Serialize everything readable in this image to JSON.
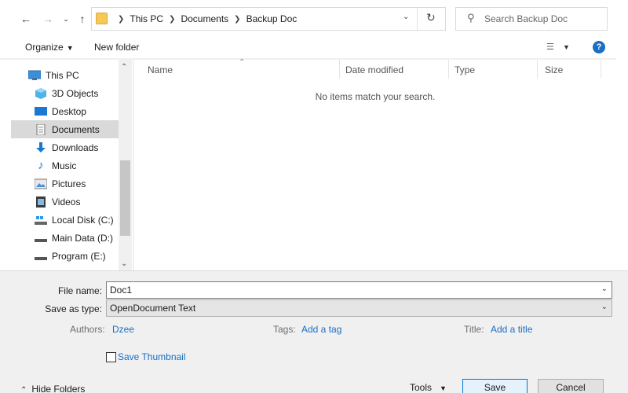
{
  "nav": {
    "back_icon": "arrow-left-icon",
    "forward_icon": "arrow-right-icon",
    "recent_icon": "chevron-down-icon",
    "up_icon": "arrow-up-icon"
  },
  "address": {
    "crumbs": [
      "This PC",
      "Documents",
      "Backup Doc"
    ]
  },
  "search": {
    "placeholder": "Search Backup Doc"
  },
  "toolbar": {
    "organize": "Organize",
    "new_folder": "New folder"
  },
  "sidebar": {
    "items": [
      {
        "label": "This PC",
        "icon": "computer-icon"
      },
      {
        "label": "3D Objects",
        "icon": "cube-icon"
      },
      {
        "label": "Desktop",
        "icon": "desktop-icon"
      },
      {
        "label": "Documents",
        "icon": "document-icon",
        "selected": true
      },
      {
        "label": "Downloads",
        "icon": "download-icon"
      },
      {
        "label": "Music",
        "icon": "music-note-icon"
      },
      {
        "label": "Pictures",
        "icon": "picture-icon"
      },
      {
        "label": "Videos",
        "icon": "video-icon"
      },
      {
        "label": "Local Disk (C:)",
        "icon": "drive-icon"
      },
      {
        "label": "Main Data (D:)",
        "icon": "drive-icon"
      },
      {
        "label": "Program (E:)",
        "icon": "drive-icon"
      }
    ]
  },
  "columns": [
    "Name",
    "Date modified",
    "Type",
    "Size"
  ],
  "empty_message": "No items match your search.",
  "form": {
    "file_name_label": "File name:",
    "file_name_value": "Doc1",
    "save_type_label": "Save as type:",
    "save_type_value": "OpenDocument Text",
    "authors_label": "Authors:",
    "authors_value": "Dzee",
    "tags_label": "Tags:",
    "tags_value": "Add a tag",
    "title_label": "Title:",
    "title_value": "Add a title",
    "thumbnail_label": "Save Thumbnail"
  },
  "footer": {
    "hide_folders": "Hide Folders",
    "tools": "Tools",
    "save": "Save",
    "cancel": "Cancel"
  },
  "colors": {
    "accent": "#0078d7",
    "link": "#1a6fc4",
    "selected_bg": "#d9d9d9"
  }
}
